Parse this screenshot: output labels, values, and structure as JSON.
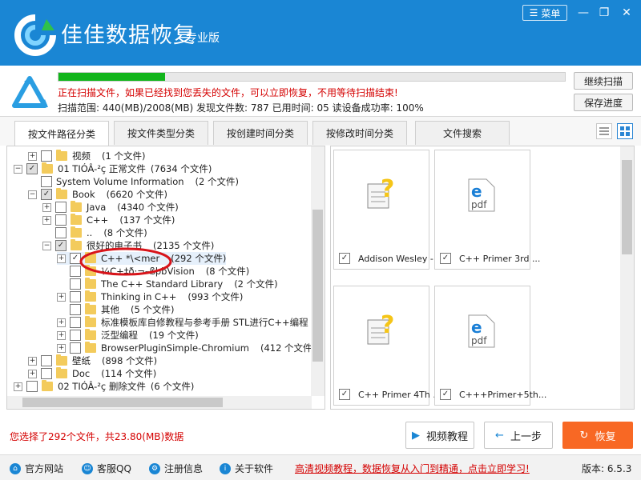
{
  "app": {
    "title": "佳佳数据恢复",
    "edition": "专业版",
    "menu_label": "菜单",
    "brand_color": "#1a86d4"
  },
  "scan": {
    "progress": 0.21,
    "message": "正在扫描文件，如果已经找到您丢失的文件，可以立即恢复，不用等待扫描结束!",
    "stats": "扫描范围: 440(MB)/2008(MB)   发现文件数: 787   已用时间: 05   读设备成功率: 100%",
    "continue_label": "继续扫描",
    "save_label": "保存进度"
  },
  "tabs": [
    {
      "label": "按文件路径分类"
    },
    {
      "label": "按文件类型分类"
    },
    {
      "label": "按创建时间分类"
    },
    {
      "label": "按修改时间分类"
    },
    {
      "label": "文件搜索"
    }
  ],
  "tree": [
    {
      "name": "视频",
      "count": "(1 个文件)"
    },
    {
      "name": "01 TIÓÂ-²ç 正常文件",
      "count": "(7634 个文件)"
    },
    {
      "name": "System Volume Information",
      "count": "(2 个文件)"
    },
    {
      "name": "Book",
      "count": "(6620 个文件)"
    },
    {
      "name": "Java",
      "count": "(4340 个文件)"
    },
    {
      "name": "C++",
      "count": "(137 个文件)"
    },
    {
      "name": "..",
      "count": "(8 个文件)"
    },
    {
      "name": "很好的电子书",
      "count": "(2135 个文件)"
    },
    {
      "name": "C++ *\\<mer",
      "count": "(292 个文件)"
    },
    {
      "name": "¼C+‡ð·¬–ßþbVision",
      "count": "(8 个文件)"
    },
    {
      "name": "The C++ Standard Library",
      "count": "(2 个文件)"
    },
    {
      "name": "Thinking in C++",
      "count": "(993 个文件)"
    },
    {
      "name": "其他",
      "count": "(5 个文件)"
    },
    {
      "name": "标准模板库自修教程与参考手册  STL进行C++编程",
      "count": ""
    },
    {
      "name": "泛型编程",
      "count": "(19 个文件)"
    },
    {
      "name": "BrowserPluginSimple-Chromium",
      "count": "(412 个文件)"
    },
    {
      "name": "壁纸",
      "count": "(898 个文件)"
    },
    {
      "name": "Doc",
      "count": "(114 个文件)"
    },
    {
      "name": "02 TIÓÂ-²ç 删除文件",
      "count": "(6 个文件)"
    }
  ],
  "files": [
    {
      "label": "Addison Wesley - ...",
      "icon": "unknown-file-icon"
    },
    {
      "label": "C++ Primer 3rd ...",
      "icon": "pdf-file-icon"
    },
    {
      "label": "C++ Primer 4Th ...",
      "icon": "unknown-file-icon"
    },
    {
      "label": "C+++Primer+5th...",
      "icon": "pdf-file-icon"
    }
  ],
  "selection_info": "您选择了292个文件，共23.80(MB)数据",
  "buttons": {
    "video_tutorial": "视频教程",
    "back": "上一步",
    "recover": "恢复",
    "recover_color": "#f86824"
  },
  "footer": {
    "links": [
      "官方网站",
      "客服QQ",
      "注册信息",
      "关于软件"
    ],
    "promo": "高清视频教程，数据恢复从入门到精通，点击立即学习!",
    "version": "版本: 6.5.3"
  }
}
